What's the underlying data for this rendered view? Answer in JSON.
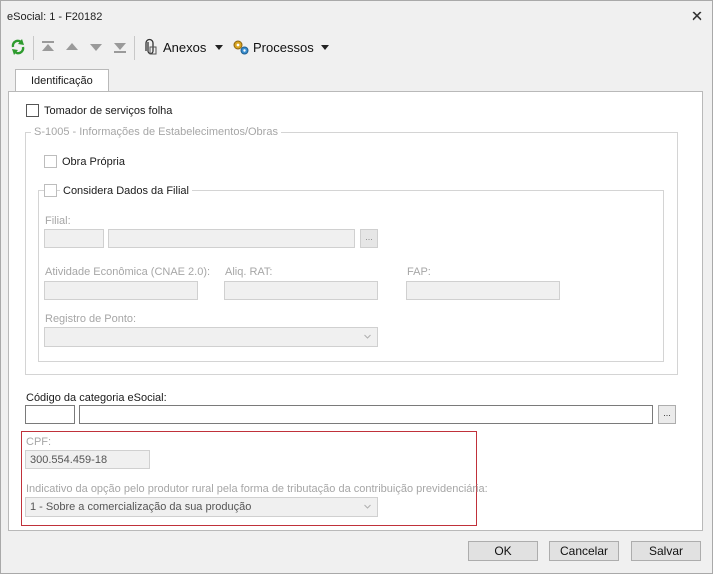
{
  "window": {
    "title": "eSocial: 1 - F20182"
  },
  "toolbar": {
    "anexos_label": "Anexos",
    "processos_label": "Processos"
  },
  "tab": {
    "label": "Identificação"
  },
  "form": {
    "tomador_label": "Tomador de serviços folha",
    "s1005_legend": "S-1005 - Informações de Estabelecimentos/Obras",
    "obra_propria_label": "Obra Própria",
    "considera_label": "Considera Dados da Filial",
    "filial_label": "Filial:",
    "cnae_label": "Atividade Econômica (CNAE 2.0):",
    "rat_label": "Aliq. RAT:",
    "fap_label": "FAP:",
    "registro_label": "Registro de Ponto:",
    "categoria_label": "Código da categoria eSocial:",
    "cpf_label": "CPF:",
    "cpf_value": "300.554.459-18",
    "indicativo_label": "Indicativo da opção pelo produtor rural pela forma de tributação da contribuição previdenciária:",
    "indicativo_value": "1 - Sobre a comercialização da sua produção",
    "dots": "..."
  },
  "buttons": {
    "ok": "OK",
    "cancel": "Cancelar",
    "save": "Salvar"
  }
}
